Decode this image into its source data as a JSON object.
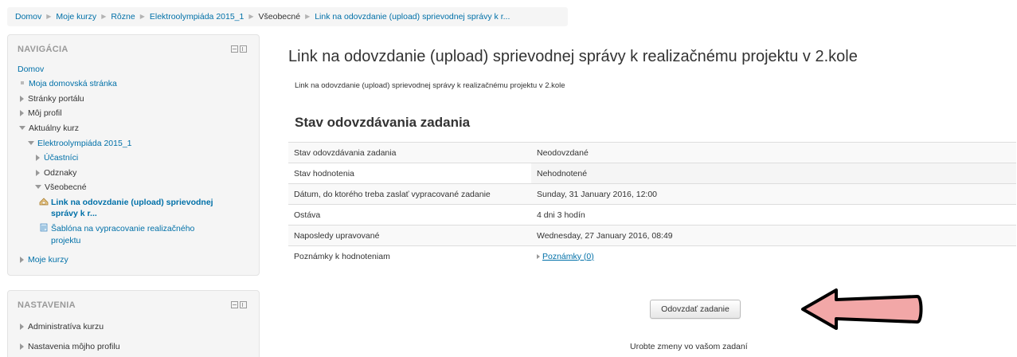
{
  "breadcrumb": {
    "items": [
      "Domov",
      "Moje kurzy",
      "Rôzne",
      "Elektroolympiáda 2015_1"
    ],
    "current_section": "Všeobecné",
    "current_link": "Link na odovzdanie (upload) sprievodnej správy k r..."
  },
  "navigation": {
    "title": "NAVIGÁCIA",
    "home": "Domov",
    "my_home": "Moja domovská stránka",
    "site_pages": "Stránky portálu",
    "my_profile": "Môj profil",
    "current_course": "Aktuálny kurz",
    "course_name": "Elektroolympiáda 2015_1",
    "participants": "Účastníci",
    "badges": "Odznaky",
    "general": "Všeobecné",
    "active_item_line1": "Link na odovzdanie (upload) sprievodnej",
    "active_item_line2": "správy k r...",
    "template_line1": "Šablóna na vypracovanie realizačného",
    "template_line2": "projektu",
    "my_courses": "Moje kurzy"
  },
  "settings": {
    "title": "NASTAVENIA",
    "course_admin": "Administratíva kurzu",
    "profile_settings": "Nastavenia môjho profilu"
  },
  "main": {
    "title": "Link na odovzdanie (upload) sprievodnej správy k realizačnému projektu v 2.kole",
    "intro": "Link na odovzdanie (upload) sprievodnej správy k realizačnému projektu v 2.kole",
    "section_title": "Stav odovzdávania zadania",
    "rows": [
      {
        "label": "Stav odovzdávania zadania",
        "value": "Neodovzdané"
      },
      {
        "label": "Stav hodnotenia",
        "value": "Nehodnotené"
      },
      {
        "label": "Dátum, do ktorého treba zaslať vypracované zadanie",
        "value": "Sunday, 31 January 2016, 12:00"
      },
      {
        "label": "Ostáva",
        "value": "4 dni 3 hodín"
      },
      {
        "label": "Naposledy upravované",
        "value": "Wednesday, 27 January 2016, 08:49"
      },
      {
        "label": "Poznámky k hodnoteniam",
        "value": "Poznámky (0)"
      }
    ],
    "submit_button": "Odovzdať zadanie",
    "help_text": "Urobte zmeny vo vašom zadaní"
  },
  "colors": {
    "link": "#0070a8",
    "arrow_fill": "#f2a7a7",
    "arrow_outline": "#000000"
  }
}
